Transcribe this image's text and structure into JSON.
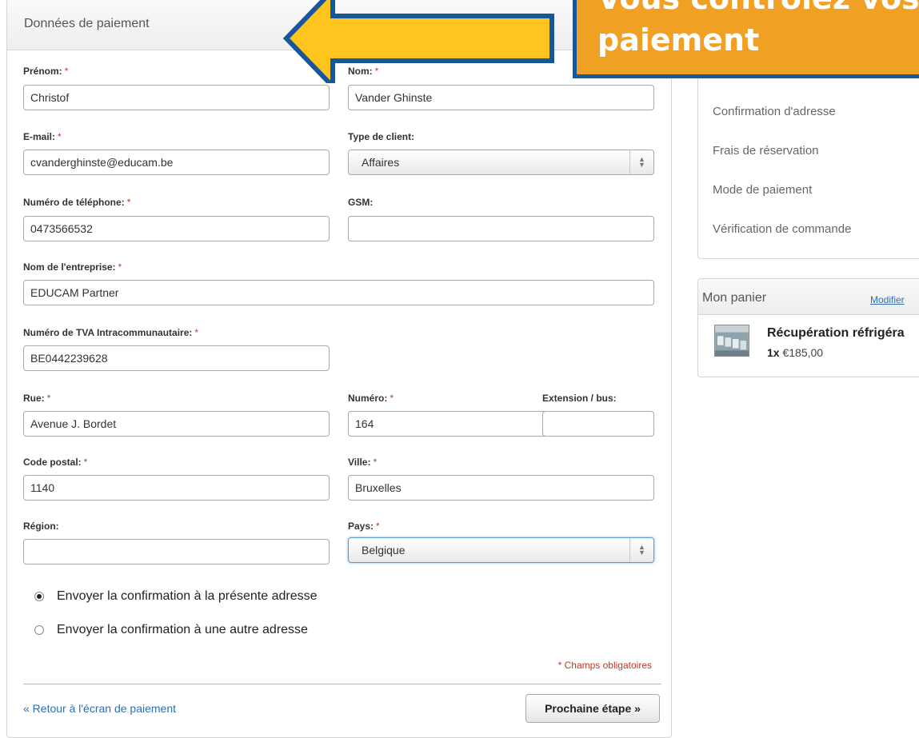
{
  "panel": {
    "title": "Données de paiement"
  },
  "form": {
    "prenom": {
      "label": "Prénom:",
      "value": "Christof"
    },
    "nom": {
      "label": "Nom:",
      "value": "Vander Ghinste"
    },
    "email": {
      "label": "E-mail:",
      "value": "cvanderghinste@educam.be"
    },
    "type_client": {
      "label": "Type de client:",
      "value": "Affaires"
    },
    "telephone": {
      "label": "Numéro de téléphone:",
      "value": "0473566532"
    },
    "gsm": {
      "label": "GSM:",
      "value": ""
    },
    "entreprise": {
      "label": "Nom de l'entreprise:",
      "value": "EDUCAM Partner"
    },
    "tva": {
      "label": "Numéro de TVA Intracommunautaire:",
      "value": "BE0442239628"
    },
    "rue": {
      "label": "Rue:",
      "value": "Avenue J. Bordet"
    },
    "numero": {
      "label": "Numéro:",
      "value": "164"
    },
    "extension": {
      "label": "Extension / bus:",
      "value": ""
    },
    "code_postal": {
      "label": "Code postal:",
      "value": "1140"
    },
    "ville": {
      "label": "Ville:",
      "value": "Bruxelles"
    },
    "region": {
      "label": "Région:",
      "value": ""
    },
    "pays": {
      "label": "Pays:",
      "value": "Belgique"
    },
    "required_marker": "*"
  },
  "confirmation": {
    "option_present": "Envoyer la confirmation à la présente adresse",
    "option_other": "Envoyer la confirmation à une autre adresse",
    "selected": "present"
  },
  "required_note": "* Champs obligatoires",
  "footer": {
    "back_link": "« Retour à l'écran de paiement",
    "next_button": "Prochaine étape »"
  },
  "steps": [
    "Confirmation d'adresse",
    "Frais de réservation",
    "Mode de paiement",
    "Vérification de commande"
  ],
  "cart": {
    "title": "Mon panier",
    "edit_link": "Modifier",
    "item_name": "Récupération réfrigéra",
    "item_qty": "1x",
    "item_price": "€185,00"
  },
  "annotation": {
    "line1": "Vous contrôlez vos d",
    "line2": "paiement"
  },
  "colors": {
    "link": "#2a6fb0",
    "required": "#c0392b",
    "callout_fill": "#f0a023",
    "callout_border": "#17569b",
    "arrow_fill": "#ffc41e",
    "arrow_border": "#17569b"
  }
}
